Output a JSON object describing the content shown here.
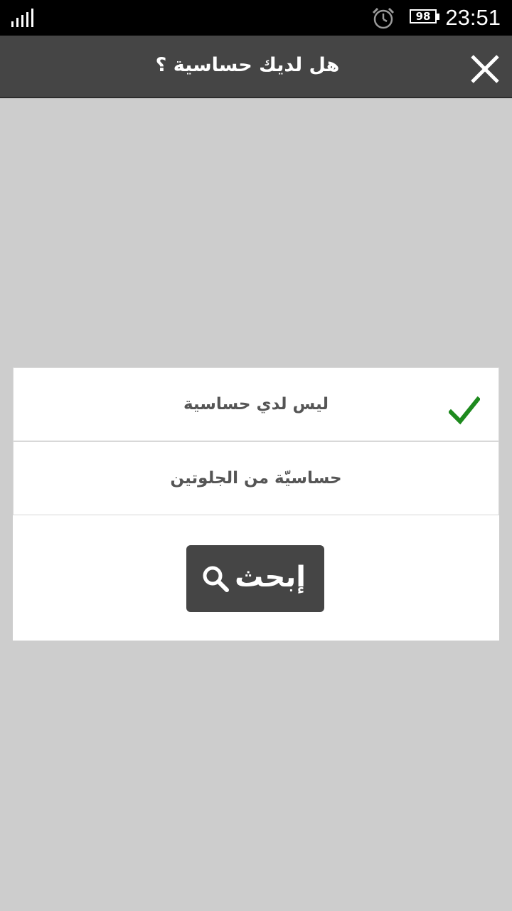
{
  "status_bar": {
    "battery_level": "98",
    "time": "23:51",
    "icons": [
      "signal-icon",
      "alarm-icon",
      "battery-icon"
    ]
  },
  "header": {
    "title": "هل لديك حساسية ؟",
    "close_icon": "close-icon"
  },
  "options": [
    {
      "label": "ليس لدي حساسية",
      "selected": true
    },
    {
      "label": "حساسيّة من الجلوتين",
      "selected": false
    }
  ],
  "search_button": {
    "label": "إبحث",
    "icon": "search-icon"
  },
  "colors": {
    "background": "#cdcdcd",
    "app_bar": "#454545",
    "check": "#1e8a1e",
    "button": "#454545"
  }
}
